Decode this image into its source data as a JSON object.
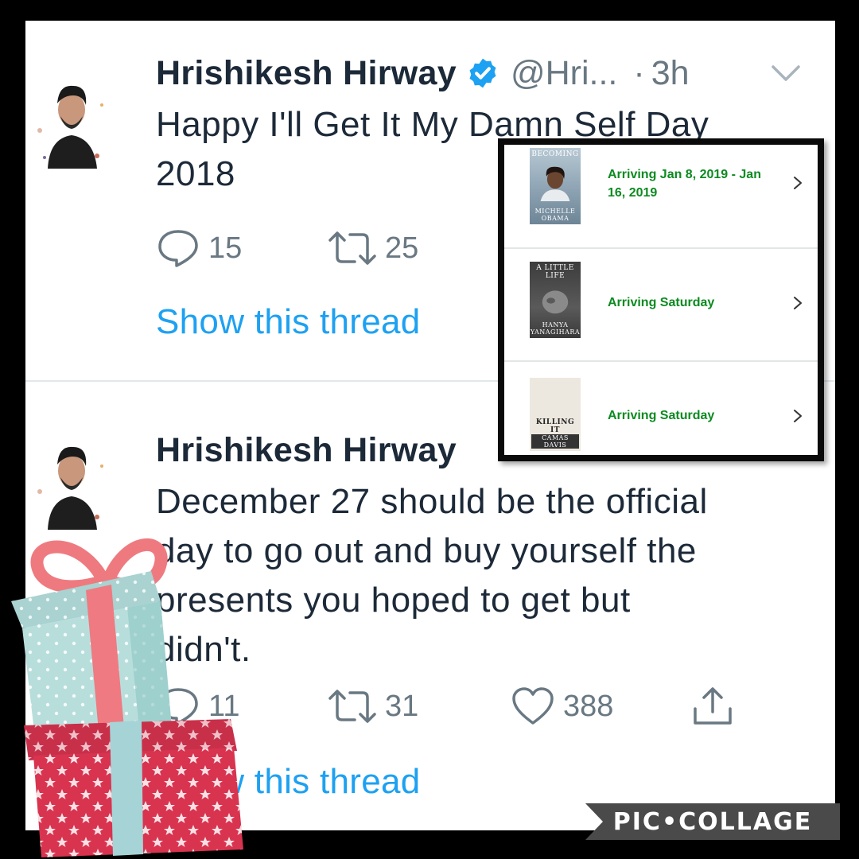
{
  "tweets": [
    {
      "name": "Hrishikesh Hirway",
      "handle": "@Hri...",
      "separator": "·",
      "time": "3h",
      "text_lines": [
        "Happy I'll Get It My Damn Self Day",
        "2018"
      ],
      "reply_count": "15",
      "retweet_count": "25",
      "show_thread": "Show this thread"
    },
    {
      "name": "Hrishikesh Hirway",
      "text_lines": [
        "December 27 should be the official",
        "day to go out and buy yourself the",
        "presents you hoped to get but",
        "didn't."
      ],
      "reply_count": "11",
      "retweet_count": "31",
      "like_count": "388",
      "show_thread": "Show this thread"
    }
  ],
  "orders": [
    {
      "book_title": "BECOMING",
      "book_author": "MICHELLE OBAMA",
      "status_lines": [
        "Arriving Jan 8, 2019 - Jan",
        "16, 2019"
      ],
      "cover_color": "#9aaebd"
    },
    {
      "book_title": "A LITTLE LIFE",
      "book_author": "HANYA YANAGIHARA",
      "status_lines": [
        "Arriving Saturday"
      ],
      "cover_color": "#4a4a4a"
    },
    {
      "book_title": "KILLING IT",
      "book_author": "CAMAS DAVIS",
      "status_lines": [
        "Arriving Saturday"
      ],
      "cover_color": "#e9e4dc"
    }
  ],
  "icons": {
    "verified": "verified-badge-icon",
    "chevron": "chevron-down-icon",
    "reply": "reply-icon",
    "retweet": "retweet-icon",
    "like": "heart-icon",
    "share": "share-icon",
    "order_chevron": "chevron-right-icon"
  },
  "colors": {
    "link": "#1da1f2",
    "verified": "#1da1f2",
    "arriving": "#0b8a1f",
    "meta": "#697882"
  },
  "watermark": "PIC•COLLAGE"
}
